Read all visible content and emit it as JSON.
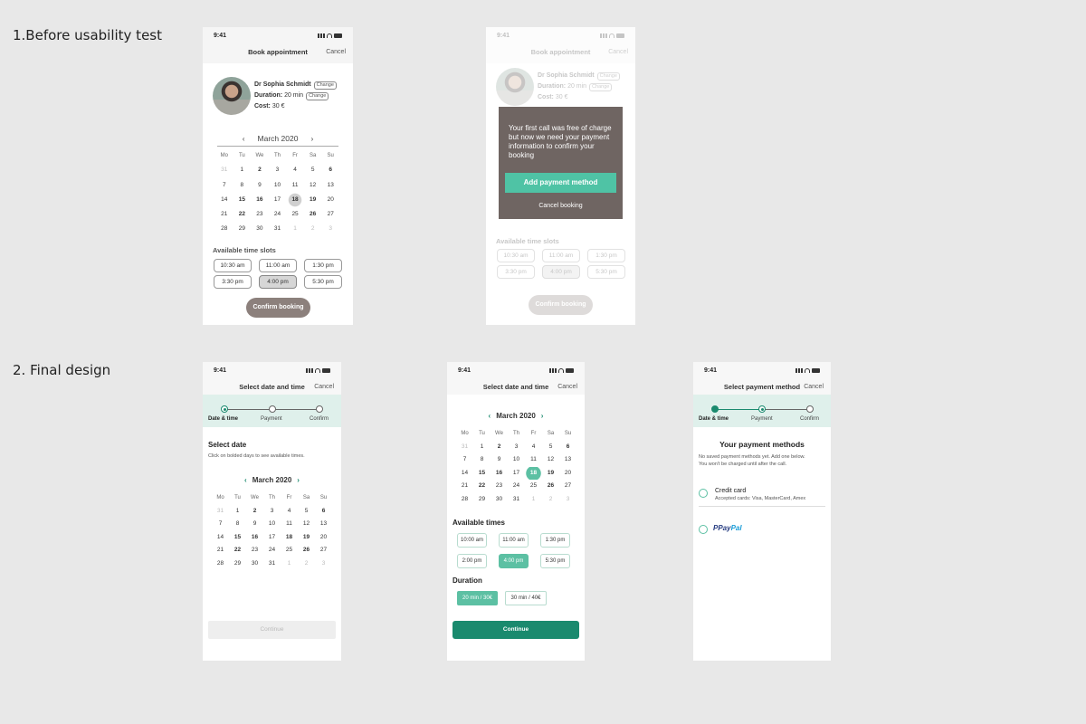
{
  "sections": {
    "before": "1.Before usability test",
    "final": "2. Final design"
  },
  "status_time": "9:41",
  "calendar": {
    "month": "March 2020",
    "weekdays": [
      "Mo",
      "Tu",
      "We",
      "Th",
      "Fr",
      "Sa",
      "Su"
    ],
    "prev": "‹",
    "next": "›",
    "days": [
      {
        "d": "31",
        "s": "m"
      },
      {
        "d": "1"
      },
      {
        "d": "2",
        "s": "b"
      },
      {
        "d": "3"
      },
      {
        "d": "4"
      },
      {
        "d": "5"
      },
      {
        "d": "6",
        "s": "b"
      },
      {
        "d": "7"
      },
      {
        "d": "8"
      },
      {
        "d": "9"
      },
      {
        "d": "10"
      },
      {
        "d": "11"
      },
      {
        "d": "12"
      },
      {
        "d": "13"
      },
      {
        "d": "14"
      },
      {
        "d": "15",
        "s": "b"
      },
      {
        "d": "16",
        "s": "b"
      },
      {
        "d": "17"
      },
      {
        "d": "18",
        "s": "b"
      },
      {
        "d": "19",
        "s": "b"
      },
      {
        "d": "20"
      },
      {
        "d": "21"
      },
      {
        "d": "22",
        "s": "b"
      },
      {
        "d": "23"
      },
      {
        "d": "24"
      },
      {
        "d": "25"
      },
      {
        "d": "26",
        "s": "b"
      },
      {
        "d": "27"
      },
      {
        "d": "28"
      },
      {
        "d": "29"
      },
      {
        "d": "30"
      },
      {
        "d": "31"
      },
      {
        "d": "1",
        "s": "m"
      },
      {
        "d": "2",
        "s": "m"
      },
      {
        "d": "3",
        "s": "m"
      }
    ],
    "selected_day": "18"
  },
  "old_booking": {
    "title": "Book appointment",
    "cancel": "Cancel",
    "doctor": "Dr Sophia Schmidt",
    "change": "Change",
    "duration_label": "Duration:",
    "duration_value": "20 min",
    "cost_label": "Cost:",
    "cost_value": "30 €",
    "slots_title": "Available time slots",
    "slots": [
      "10:30 am",
      "11:00 am",
      "1:30 pm",
      "3:30 pm",
      "4:00 pm",
      "5:30 pm"
    ],
    "selected_slot": "4:00 pm",
    "confirm": "Confirm booking"
  },
  "old_modal": {
    "message": "Your first call was free of charge but now we need your payment information to confirm your booking",
    "add_payment": "Add payment method",
    "cancel_booking": "Cancel booking"
  },
  "steps": [
    "Date & time",
    "Payment",
    "Confirm"
  ],
  "final_date": {
    "title": "Select date and time",
    "cancel": "Cancel",
    "heading": "Select date",
    "hint": "Click on bolded days to see available times.",
    "continue": "Continue"
  },
  "final_time": {
    "title": "Select date and time",
    "cancel": "Cancel",
    "times_title": "Available times",
    "times": [
      "10:00 am",
      "11:00 am",
      "1:30 pm",
      "2:00 pm",
      "4:00 pm",
      "5:30 pm"
    ],
    "selected_time": "4:00 pm",
    "duration_title": "Duration",
    "durations": [
      "20 min / 30€",
      "30 min / 40€"
    ],
    "continue": "Continue"
  },
  "final_payment": {
    "title": "Select payment method",
    "cancel": "Cancel",
    "heading": "Your payment methods",
    "note_line1": "No saved payment methods yet. Add one below.",
    "note_line2": "You won't be charged until after the call.",
    "credit_card": "Credit card",
    "accepted": "Accepted cards: Visa, MasterCard, Amex",
    "paypal_pay": "Pay",
    "paypal_pal": "Pal"
  },
  "colors": {
    "accent": "#5cc0a3",
    "accent_dark": "#1a8a6e",
    "stepper_bg": "#dff0eb",
    "modal_bg": "#6f6562"
  }
}
